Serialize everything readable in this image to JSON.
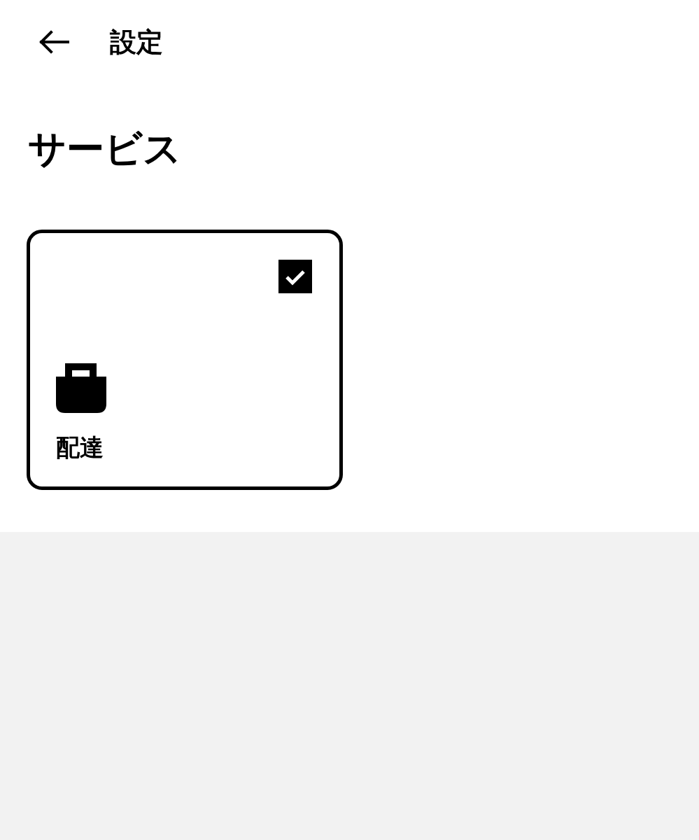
{
  "header": {
    "title": "設定"
  },
  "section": {
    "title": "サービス"
  },
  "services": [
    {
      "label": "配達",
      "selected": true
    }
  ]
}
